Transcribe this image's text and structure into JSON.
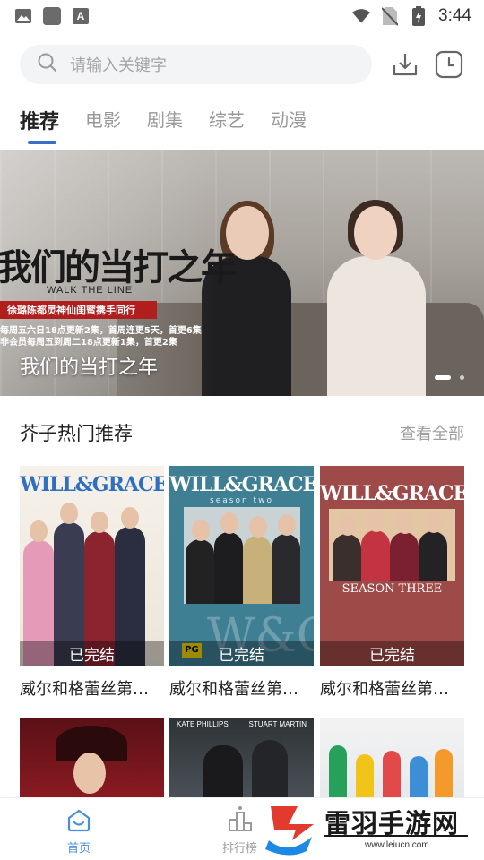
{
  "status_bar": {
    "time": "3:44",
    "left_icons": [
      "image-icon",
      "app-icon",
      "font-app-icon"
    ],
    "right_icons": [
      "wifi-icon",
      "no-sim-icon",
      "battery-charging-icon"
    ]
  },
  "search": {
    "placeholder": "请输入关键字",
    "download_icon": "download-icon",
    "history_icon": "history-icon"
  },
  "tabs": [
    {
      "label": "推荐",
      "active": true
    },
    {
      "label": "电影",
      "active": false
    },
    {
      "label": "剧集",
      "active": false
    },
    {
      "label": "综艺",
      "active": false
    },
    {
      "label": "动漫",
      "active": false
    }
  ],
  "banner": {
    "title": "我们的当打之年",
    "logo_text": "我们的当打之年",
    "logo_en": "WALK THE LINE",
    "strip_text": "徐璐陈都灵神仙闺蜜携手同行",
    "note_1": "每周五六日18点更新2集，首周连更5天，首更6集",
    "note_2": "非会员每周五到周二18点更新1集，首更2集",
    "slide_count": 2,
    "active_slide": 0
  },
  "section": {
    "title": "芥子热门推荐",
    "more": "查看全部"
  },
  "cards_row1": [
    {
      "title": "威尔和格蕾丝第…",
      "status": "已完结",
      "poster_title": "WILL&GRACE",
      "poster_sub": ""
    },
    {
      "title": "威尔和格蕾丝第…",
      "status": "已完结",
      "poster_title": "WILL&GRACE",
      "poster_sub": "season two"
    },
    {
      "title": "威尔和格蕾丝第…",
      "status": "已完结",
      "poster_title": "WILL&GRACE",
      "poster_sub": "SEASON THREE"
    }
  ],
  "cards_row2": [
    {
      "poster_caption": ""
    },
    {
      "poster_caption_1": "KATE PHILLIPS",
      "poster_caption_2": "STUART MARTIN"
    },
    {
      "poster_caption": ""
    }
  ],
  "bottom_nav": [
    {
      "label": "首页",
      "icon": "home-icon",
      "active": true
    },
    {
      "label": "排行榜",
      "icon": "ranking-icon",
      "active": false
    }
  ],
  "watermark": {
    "text": "雷羽手游网",
    "url": "www.leiucn.com"
  },
  "colors": {
    "accent": "#3a6fc8",
    "nav_active": "#4a90d9",
    "banner_strip": "#b01e1e"
  }
}
